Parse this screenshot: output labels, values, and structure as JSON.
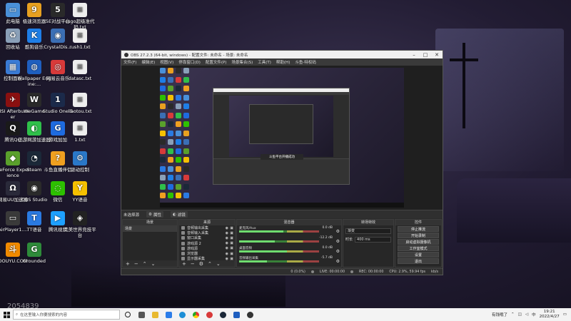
{
  "desktop": {
    "icons": [
      {
        "label": "此电脑",
        "icon": "computer-icon",
        "color": "#4a90d9",
        "glyph": "▭"
      },
      {
        "label": "极速浏览器",
        "icon": "browser-icon",
        "color": "#e8a020",
        "glyph": "9"
      },
      {
        "label": "5E对战平台",
        "icon": "5e-icon",
        "color": "#2a2a2a",
        "glyph": "5"
      },
      {
        "label": "csgo超级准代码.txt",
        "icon": "text-file-icon",
        "color": "#eeeeee",
        "glyph": "≡"
      },
      {
        "label": "回收站",
        "icon": "recycle-bin-icon",
        "color": "#8aa0b8",
        "glyph": "♻"
      },
      {
        "label": "酷狗音乐",
        "icon": "kugou-icon",
        "color": "#1e7ee6",
        "glyph": "K"
      },
      {
        "label": "CrystalDis...",
        "icon": "crystaldisk-icon",
        "color": "#3b6fb5",
        "glyph": "◉"
      },
      {
        "label": "rush1.txt",
        "icon": "text-file-icon",
        "color": "#eeeeee",
        "glyph": "≡"
      },
      {
        "label": "控制面板",
        "icon": "control-panel-icon",
        "color": "#3a7bd5",
        "glyph": "▦"
      },
      {
        "label": "Wallpaper Engine:...",
        "icon": "wallpaper-engine-icon",
        "color": "#1f5fbf",
        "glyph": "◍"
      },
      {
        "label": "网易云音乐",
        "icon": "netease-music-icon",
        "color": "#d83a3a",
        "glyph": "◎"
      },
      {
        "label": "datasc.txt",
        "icon": "text-file-icon",
        "color": "#eeeeee",
        "glyph": "≡"
      },
      {
        "label": "MSI Afterburner",
        "icon": "msi-afterburner-icon",
        "color": "#8a1010",
        "glyph": "✈"
      },
      {
        "label": "WeGame",
        "icon": "wegame-icon",
        "color": "#2a2a2a",
        "glyph": "W"
      },
      {
        "label": "Studio One 5",
        "icon": "studio-one-icon",
        "color": "#1b2a4a",
        "glyph": "1"
      },
      {
        "label": "liaotou.txt",
        "icon": "text-file-icon",
        "color": "#eeeeee",
        "glyph": "≡"
      },
      {
        "label": "腾讯QQ",
        "icon": "qq-icon",
        "color": "#1a1a1a",
        "glyph": "Q"
      },
      {
        "label": "迅游网游加速器",
        "icon": "xunyou-icon",
        "color": "#2fbf4a",
        "glyph": "◐"
      },
      {
        "label": "游戏加加",
        "icon": "youxijiajia-icon",
        "color": "#1e6be0",
        "glyph": "G"
      },
      {
        "label": "1.txt",
        "icon": "text-file-icon",
        "color": "#eeeeee",
        "glyph": "≡"
      },
      {
        "label": "GeForce Experience",
        "icon": "geforce-icon",
        "color": "#5aa02c",
        "glyph": "◆"
      },
      {
        "label": "Steam",
        "icon": "steam-icon",
        "color": "#1b2838",
        "glyph": "◔"
      },
      {
        "label": "斗鱼直播伴侣",
        "icon": "douyu-companion-icon",
        "color": "#f0a020",
        "glyph": "?"
      },
      {
        "label": "驱动控制",
        "icon": "driver-icon",
        "color": "#2a78c8",
        "glyph": "⚙"
      },
      {
        "label": "网易UU加速器",
        "icon": "uu-accelerator-icon",
        "color": "#2a2a3a",
        "glyph": "Ω"
      },
      {
        "label": "OBS Studio",
        "icon": "obs-icon",
        "color": "#2a2a2a",
        "glyph": "◉"
      },
      {
        "label": "微信",
        "icon": "wechat-icon",
        "color": "#2dc100",
        "glyph": "◌"
      },
      {
        "label": "YY语音",
        "icon": "yy-icon",
        "color": "#f5c000",
        "glyph": "Y"
      },
      {
        "label": "AirPlayer1....",
        "icon": "airplayer-icon",
        "color": "#3a3a3a",
        "glyph": "▭"
      },
      {
        "label": "TT语音",
        "icon": "tt-voice-icon",
        "color": "#2a7ae2",
        "glyph": "T"
      },
      {
        "label": "腾讯视频",
        "icon": "tencent-video-icon",
        "color": "#1ea0ff",
        "glyph": "▶"
      },
      {
        "label": "完美世界竞技平台",
        "icon": "perfect-world-icon",
        "color": "#222222",
        "glyph": "◈"
      },
      {
        "label": "DOUYU.COM",
        "icon": "douyu-logo-icon",
        "color": "#f08a00",
        "glyph": "斗"
      },
      {
        "label": "Grounded",
        "icon": "grounded-icon",
        "color": "#2e8b3a",
        "glyph": "G"
      }
    ]
  },
  "obs": {
    "title": "OBS 27.2.3 (64-bit, windows) - 配置文件: 未命名 - 场景: 未命名",
    "menu": [
      "文件(F)",
      "编辑(E)",
      "视图(V)",
      "停靠窗口(D)",
      "配置文件(P)",
      "场景集合(S)",
      "工具(T)",
      "帮助(H)",
      "斗鱼-特权码"
    ],
    "toast": "斗鱼平台开播成功",
    "scene_strip": {
      "label": "未选择源",
      "properties": "属性",
      "filters": "滤镜"
    },
    "scenes": {
      "header": "场景",
      "items": [
        "场景"
      ]
    },
    "sources": {
      "header": "来源",
      "items": [
        "音频输出采集",
        "音频输入采集",
        "窗口采集",
        "游戏源 2",
        "游戏源",
        "浏览器",
        "显示器采集"
      ]
    },
    "mixer": {
      "header": "混音器",
      "items": [
        {
          "name": "麦克风/Aux",
          "db": "0.0 dB",
          "level": 0.55
        },
        {
          "name": "",
          "db": "-12.2 dB",
          "level": 0.45
        },
        {
          "name": "桌面音频",
          "db": "0.0 dB",
          "level": 0.6
        },
        {
          "name": "音频输出采集",
          "db": "-5.7 dB",
          "level": 0.35
        }
      ]
    },
    "transitions": {
      "header": "转场特效",
      "type": "渐变",
      "duration_label": "时长",
      "duration": "400 ms"
    },
    "controls": {
      "header": "控件",
      "buttons": [
        "停止推流",
        "开始录制",
        "启动虚拟摄像机",
        "工作室模式",
        "设置",
        "退出"
      ]
    },
    "status": {
      "live": "LIVE: 00:00:00",
      "rec": "REC: 00:00:00",
      "cpu": "CPU: 2.9%, 59.94 fps",
      "dropped": "0 (0.0%)",
      "kbps": "kb/s"
    }
  },
  "taskbar": {
    "search_placeholder": "在这里输入你要搜索的内容",
    "tray_text": "有钱哦了",
    "time": "19:21",
    "date": "2022/4/27"
  },
  "wallpaper": {
    "watermark": "2054839"
  }
}
